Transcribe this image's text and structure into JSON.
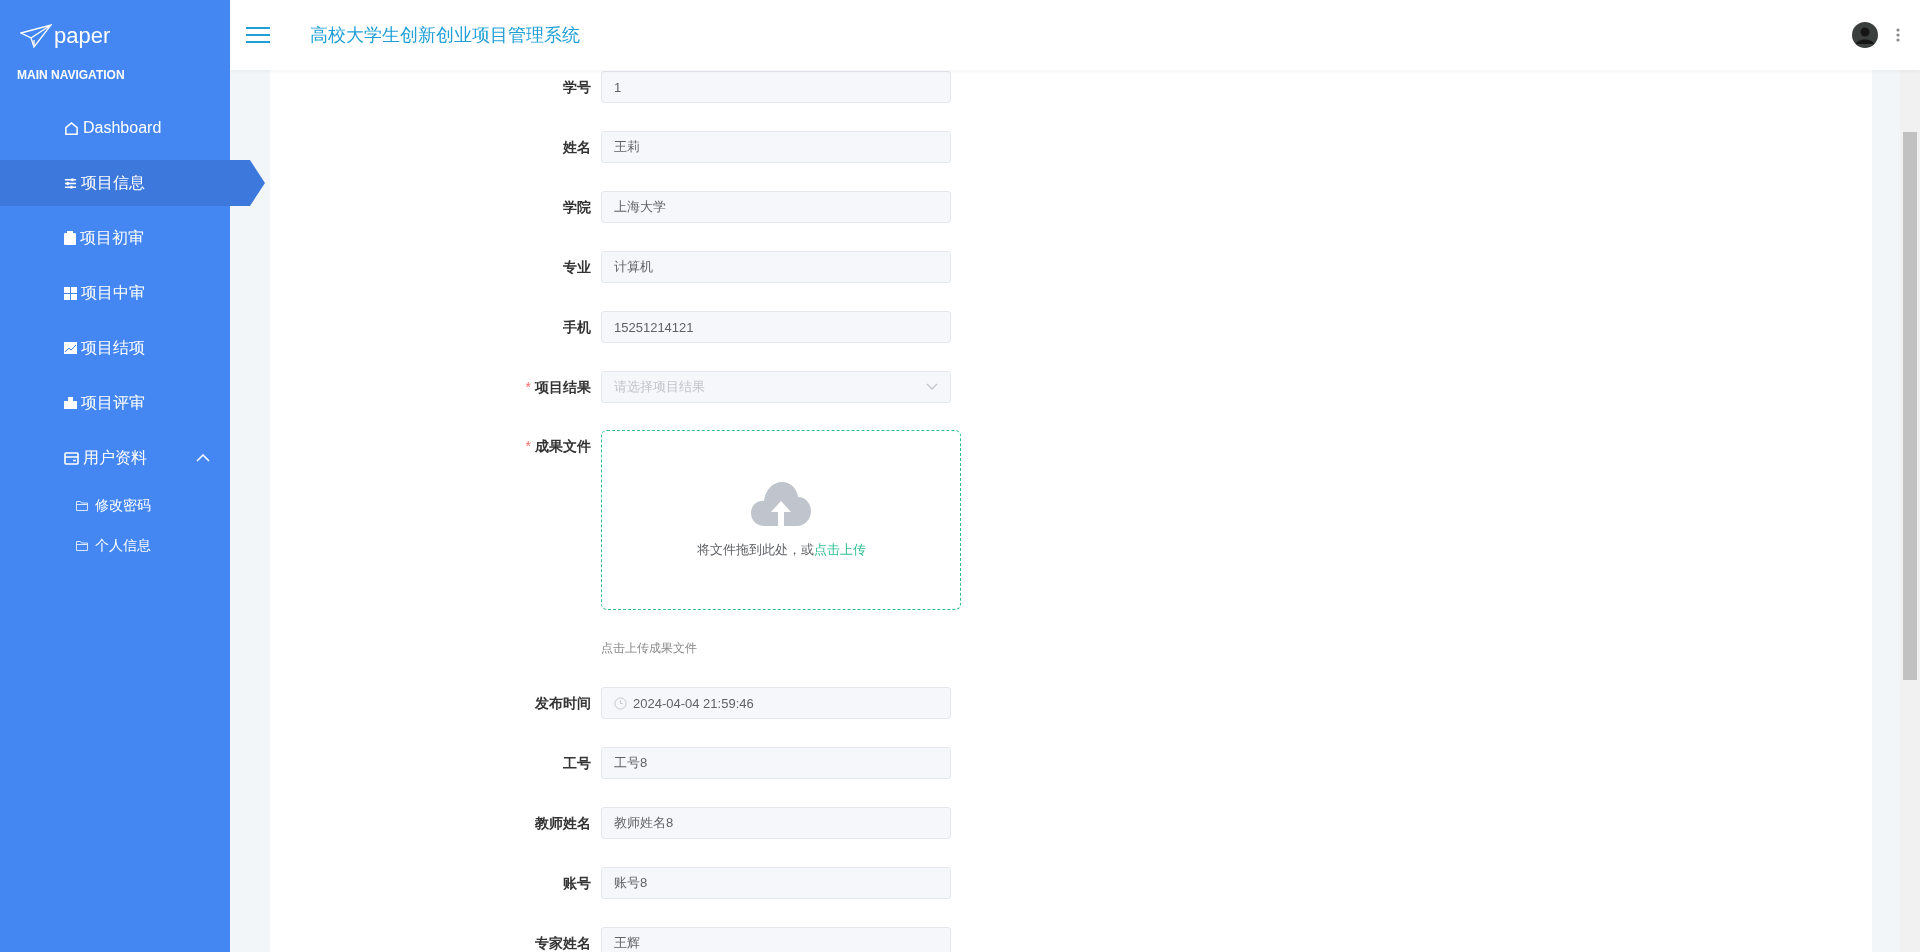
{
  "sidebar": {
    "logo": "paper",
    "section_title": "MAIN NAVIGATION",
    "items": [
      {
        "label": "Dashboard",
        "selected": false
      },
      {
        "label": "项目信息",
        "selected": true
      },
      {
        "label": "项目初审",
        "selected": false
      },
      {
        "label": "项目中审",
        "selected": false
      },
      {
        "label": "项目结项",
        "selected": false
      },
      {
        "label": "项目评审",
        "selected": false
      },
      {
        "label": "用户资料",
        "selected": false,
        "expanded": true,
        "children": [
          {
            "label": "修改密码"
          },
          {
            "label": "个人信息"
          }
        ]
      }
    ]
  },
  "header": {
    "title": "高校大学生创新创业项目管理系统"
  },
  "form": {
    "fields": [
      {
        "kind": "input",
        "label": "学号",
        "value": "1"
      },
      {
        "kind": "input",
        "label": "姓名",
        "value": "王莉"
      },
      {
        "kind": "input",
        "label": "学院",
        "value": "上海大学"
      },
      {
        "kind": "input",
        "label": "专业",
        "value": "计算机"
      },
      {
        "kind": "input",
        "label": "手机",
        "value": "15251214121"
      },
      {
        "kind": "select",
        "label": "项目结果",
        "placeholder": "请选择项目结果",
        "required_mark": "*"
      },
      {
        "kind": "upload",
        "label": "成果文件",
        "required_mark": "*",
        "prompt": "将文件拖到此处，或",
        "link": "点击上传",
        "tip": "点击上传成果文件"
      },
      {
        "kind": "date",
        "label": "发布时间",
        "value": "2024-04-04 21:59:46"
      },
      {
        "kind": "input",
        "label": "工号",
        "value": "工号8"
      },
      {
        "kind": "input",
        "label": "教师姓名",
        "value": "教师姓名8"
      },
      {
        "kind": "input",
        "label": "账号",
        "value": "账号8"
      },
      {
        "kind": "input",
        "label": "专家姓名",
        "value": "王辉"
      }
    ]
  }
}
